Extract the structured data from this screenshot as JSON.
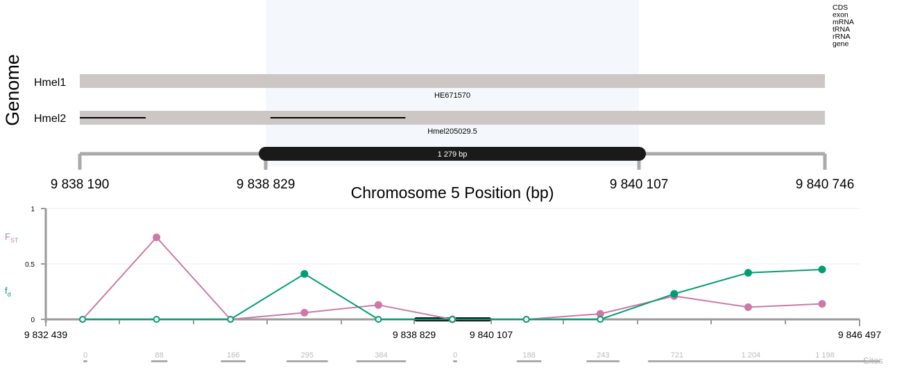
{
  "genome_panel": {
    "title": "Genome",
    "legend": [
      "CDS",
      "exon",
      "mRNA",
      "tRNA",
      "rRNA",
      "gene"
    ],
    "assemblies": [
      {
        "label": "Hmel1",
        "scaffold": "HE671570",
        "alignments": []
      },
      {
        "label": "Hmel2",
        "scaffold": "Hmel205029.5",
        "alignments": [
          [
            9838190,
            9838416
          ],
          [
            9838844,
            9839307
          ]
        ]
      }
    ],
    "region": {
      "start": 9838190,
      "end": 9840746
    },
    "highlight": {
      "start": 9838829,
      "end": 9840107
    },
    "highlight_label": "1 279 bp",
    "tick_labels": [
      "9 838 190",
      "9 838 829",
      "9 840 107",
      "9 840 746"
    ],
    "axis_title": "Chromosome 5 Position (bp)"
  },
  "colors": {
    "fst": "#cc79a7",
    "fd": "#009e73",
    "highlight": "#f4f8fc",
    "scaffold": "#ccc7c5",
    "axis": "#999999",
    "dark": "#1a1a1a",
    "sites": "#bbbbbb"
  },
  "chart_data": {
    "type": "line",
    "x_start_label": "9 832 439",
    "x_end_label": "9 846 497",
    "highlight_labels": [
      "9 838 829",
      "9 840 107"
    ],
    "ylim": [
      0,
      1
    ],
    "y_tick_labels": [
      "0",
      "0.5",
      "1"
    ],
    "fst_label": {
      "main": "F",
      "sub": "ST"
    },
    "fd_label": {
      "main": "f",
      "sub": "d"
    },
    "windows": [
      0,
      1,
      2,
      3,
      4,
      5,
      6,
      7,
      8,
      9,
      10
    ],
    "series": [
      {
        "key": "fst",
        "values": [
          0,
          0.74,
          0,
          0.06,
          0.13,
          0,
          0,
          0.05,
          0.21,
          0.11,
          0.14
        ],
        "filled": [
          false,
          true,
          false,
          true,
          true,
          true,
          false,
          true,
          true,
          true,
          true
        ]
      },
      {
        "key": "fd",
        "values": [
          0,
          0,
          0,
          0.41,
          0,
          0,
          0,
          0,
          0.23,
          0.42,
          0.45
        ],
        "filled": [
          false,
          false,
          false,
          true,
          false,
          false,
          false,
          false,
          true,
          true,
          true
        ]
      }
    ],
    "sites": {
      "label": "Sites",
      "values": [
        "0",
        "88",
        "166",
        "295",
        "384",
        "0",
        "188",
        "243",
        "721",
        "1 204",
        "1 198"
      ],
      "bar_widths": [
        0.03,
        0.12,
        0.18,
        0.3,
        0.36,
        0.03,
        0.18,
        0.24,
        0.42,
        0.78,
        0.8
      ]
    }
  }
}
